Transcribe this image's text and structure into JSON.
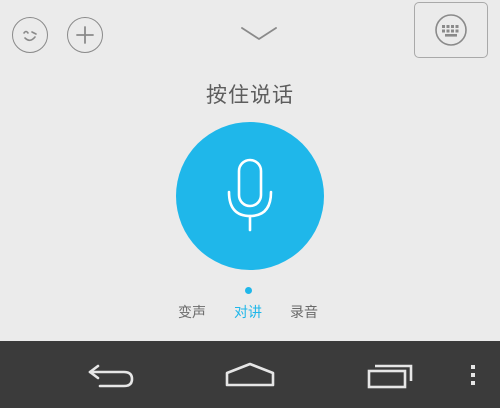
{
  "toolbar": {
    "emoji_icon": "smiley-face-icon",
    "plus_icon": "plus-icon",
    "collapse_icon": "chevron-down-icon",
    "keyboard_icon": "keyboard-icon"
  },
  "voice": {
    "title": "按住说话",
    "mic_icon": "microphone-icon",
    "accent_color": "#1fb7ea"
  },
  "modes": [
    {
      "label": "变声",
      "active": false
    },
    {
      "label": "对讲",
      "active": true
    },
    {
      "label": "录音",
      "active": false
    }
  ],
  "navbar": {
    "back_icon": "back-arrow-icon",
    "home_icon": "home-icon",
    "recents_icon": "recent-apps-icon",
    "menu_icon": "overflow-menu-icon",
    "background": "#3b3b3b"
  }
}
